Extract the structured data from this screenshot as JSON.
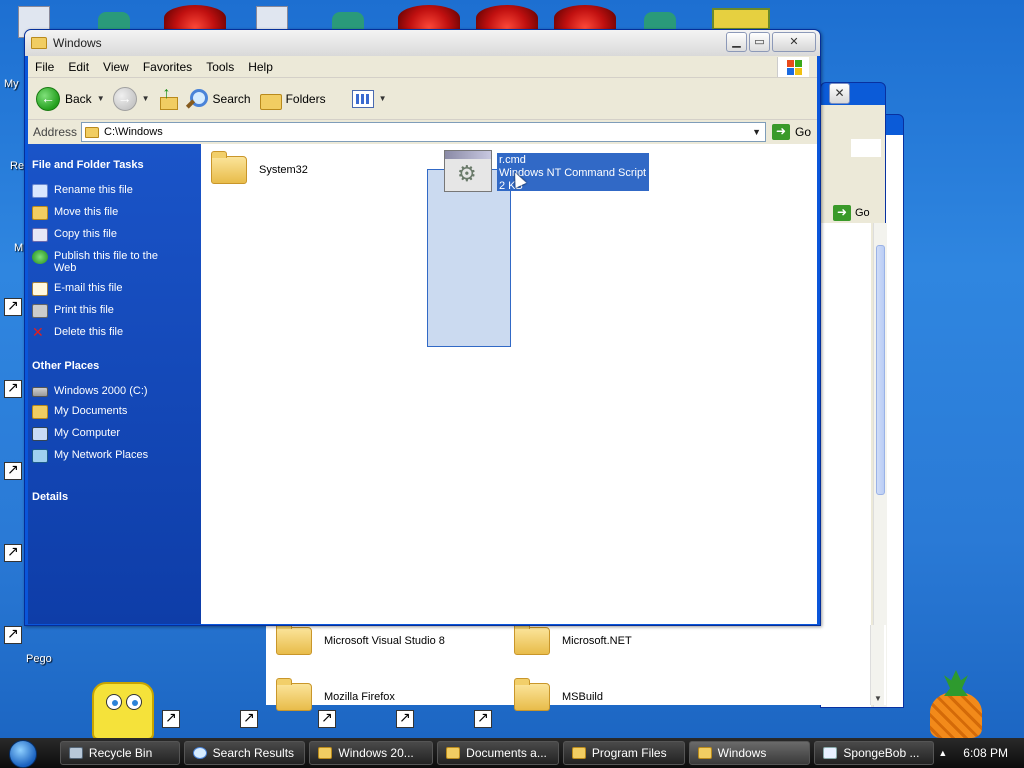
{
  "desktop": {
    "labels": {
      "my": "My",
      "re": "Re",
      "m": "M",
      "pego": "Pego"
    }
  },
  "main_window": {
    "title": "Windows",
    "menu": [
      "File",
      "Edit",
      "View",
      "Favorites",
      "Tools",
      "Help"
    ],
    "toolbar": {
      "back": "Back",
      "search": "Search",
      "folders": "Folders"
    },
    "address": {
      "label": "Address",
      "value": "C:\\Windows",
      "go": "Go"
    },
    "tasks_header": "File and Folder Tasks",
    "tasks": [
      "Rename this file",
      "Move this file",
      "Copy this file",
      "Publish this file to the Web",
      "E-mail this file",
      "Print this file",
      "Delete this file"
    ],
    "other_header": "Other Places",
    "other_places": [
      "Windows 2000 (C:)",
      "My Documents",
      "My Computer",
      "My Network Places"
    ],
    "details_header": "Details",
    "files": [
      {
        "name": "System32"
      },
      {
        "name": "r.cmd",
        "type": "Windows NT Command Script",
        "size": "2 KB"
      }
    ]
  },
  "bg_window": {
    "go": "Go",
    "folders": [
      "Microsoft Visual Studio 8",
      "Microsoft.NET",
      "Mozilla Firefox",
      "MSBuild"
    ]
  },
  "taskbar": {
    "buttons": [
      "Recycle Bin",
      "Search Results",
      "Windows 20...",
      "Documents a...",
      "Program Files",
      "Windows",
      "SpongeBob ..."
    ],
    "active": "Windows",
    "time": "6:08 PM"
  }
}
